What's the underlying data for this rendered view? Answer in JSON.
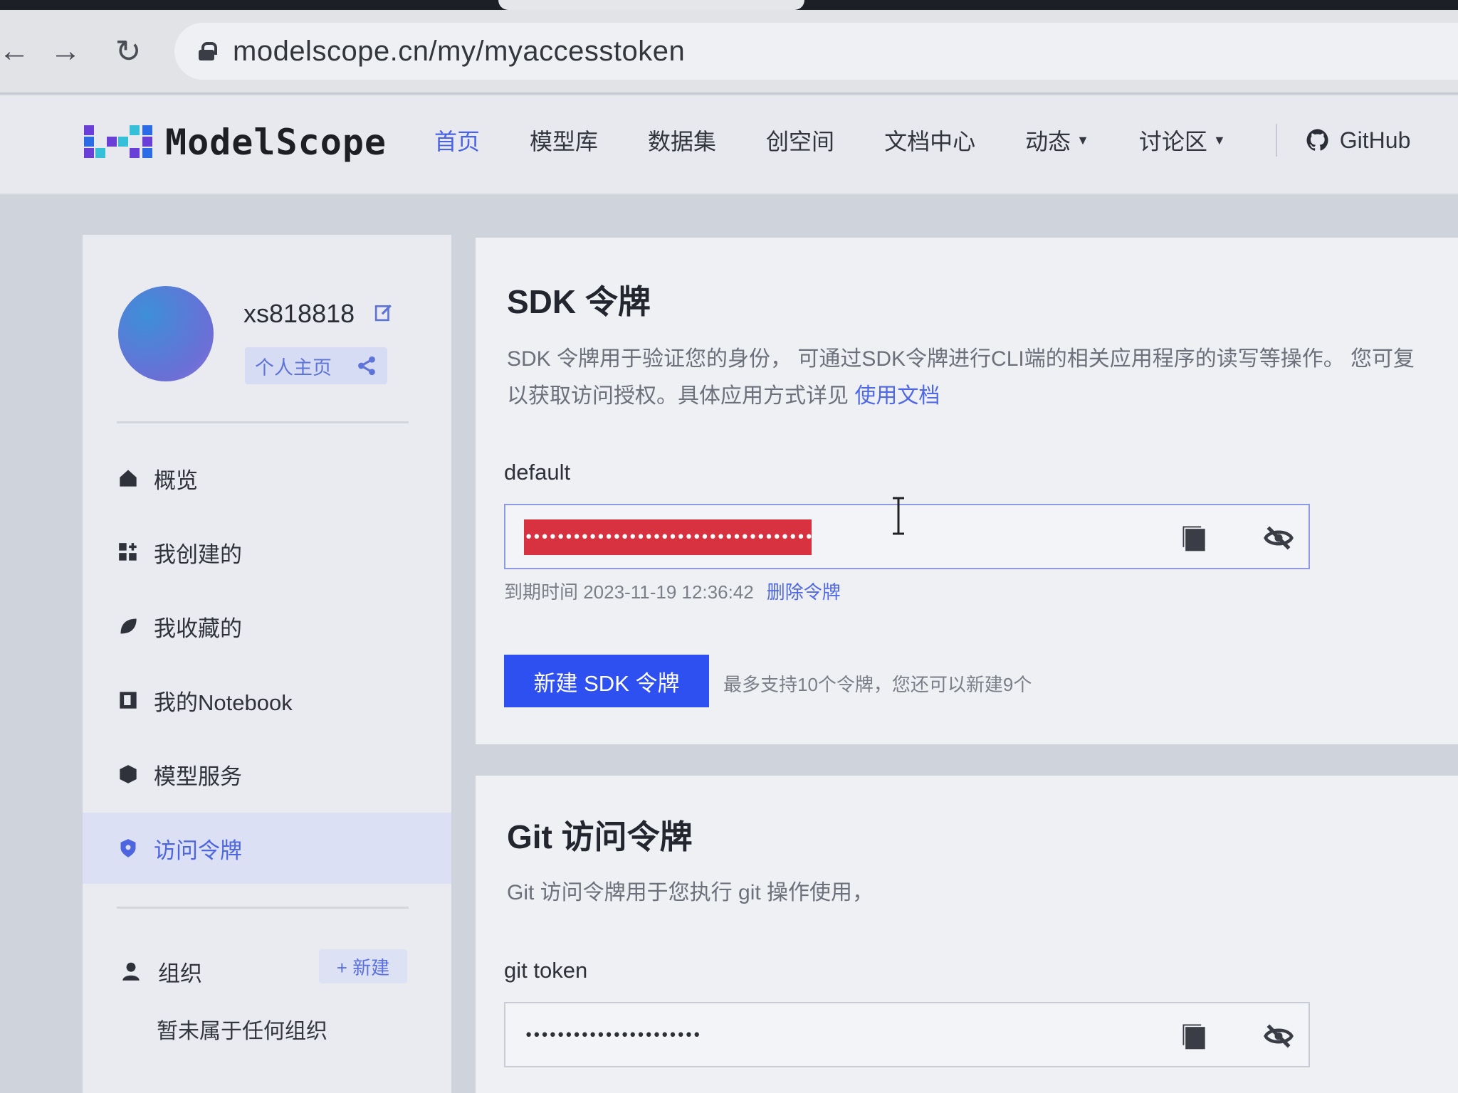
{
  "browser": {
    "back_icon": "arrow-left-icon",
    "forward_icon": "arrow-right-icon",
    "reload_icon": "reload-icon",
    "url": "modelscope.cn/my/myaccesstoken"
  },
  "header": {
    "logo_text": "ModelScope",
    "nav": [
      {
        "label": "首页",
        "active": true
      },
      {
        "label": "模型库"
      },
      {
        "label": "数据集"
      },
      {
        "label": "创空间"
      },
      {
        "label": "文档中心"
      },
      {
        "label": "动态",
        "dropdown": true
      },
      {
        "label": "讨论区",
        "dropdown": true
      }
    ],
    "github_label": "GitHub",
    "accent_color": "#4a63e6"
  },
  "sidebar": {
    "username": "xs818818",
    "home_label": "个人主页",
    "menu": [
      {
        "label": "概览",
        "icon": "home-icon"
      },
      {
        "label": "我创建的",
        "icon": "grid-add-icon"
      },
      {
        "label": "我收藏的",
        "icon": "leaf-icon"
      },
      {
        "label": "我的Notebook",
        "icon": "notebook-icon"
      },
      {
        "label": "模型服务",
        "icon": "cube-icon"
      },
      {
        "label": "访问令牌",
        "icon": "shield-icon",
        "active": true
      }
    ],
    "org_label": "组织",
    "new_org_label": "+ 新建",
    "no_org_text": "暂未属于任何组织"
  },
  "sdk": {
    "title": "SDK 令牌",
    "desc_line1": "SDK 令牌用于验证您的身份， 可通过SDK令牌进行CLI端的相关应用程序的读写等操作。 您可复",
    "desc_line2": "以获取访问授权。具体应用方式详见 ",
    "doc_link": "使用文档",
    "token_name": "default",
    "token_masked": "••••••••••••••••••••••••••••••••••••",
    "expire_label": "到期时间 2023-11-19 12:36:42",
    "delete_label": "删除令牌",
    "new_button": "新建 SDK 令牌",
    "limit_hint": "最多支持10个令牌，您还可以新建9个",
    "redaction_color": "#d8313f",
    "button_color": "#2f50f0"
  },
  "git": {
    "title": "Git 访问令牌",
    "desc": "Git 访问令牌用于您执行 git 操作使用，",
    "token_name": "git token",
    "token_masked": "••••••••••••••••••••••"
  }
}
